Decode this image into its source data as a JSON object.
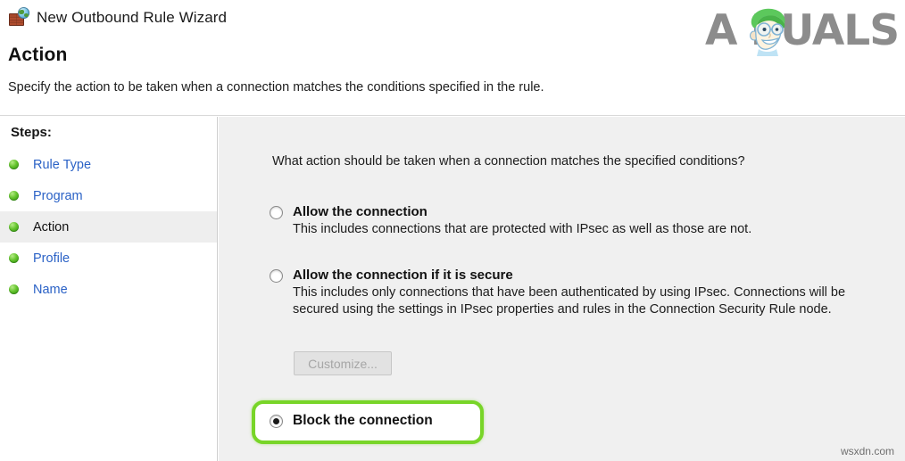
{
  "window": {
    "title": "New Outbound Rule Wizard",
    "icon": "firewall-globe-icon"
  },
  "header": {
    "page_title": "Action",
    "subtitle": "Specify the action to be taken when a connection matches the conditions specified in the rule."
  },
  "logo": {
    "text": "A      PUALS",
    "alt": "appuals-logo",
    "hair_color": "#5cc85c",
    "text_color": "#8c8c8c"
  },
  "sidebar": {
    "heading": "Steps:",
    "items": [
      {
        "label": "Rule Type",
        "state": "completed"
      },
      {
        "label": "Program",
        "state": "completed"
      },
      {
        "label": "Action",
        "state": "current"
      },
      {
        "label": "Profile",
        "state": "completed"
      },
      {
        "label": "Name",
        "state": "completed"
      }
    ]
  },
  "main": {
    "question": "What action should be taken when a connection matches the specified conditions?",
    "options": [
      {
        "id": "allow",
        "title": "Allow the connection",
        "description": "This includes connections that are protected with IPsec as well as those are not.",
        "selected": false
      },
      {
        "id": "allow-if-secure",
        "title": "Allow the connection if it is secure",
        "description": "This includes only connections that have been authenticated by using IPsec.  Connections will be secured using the settings in IPsec properties and rules in the Connection Security Rule node.",
        "selected": false
      },
      {
        "id": "block",
        "title": "Block the connection",
        "description": "",
        "selected": true
      }
    ],
    "customize_button": {
      "label": "Customize...",
      "enabled": false
    },
    "highlight": {
      "target": "block",
      "color": "#78d528"
    }
  },
  "watermark": "wsxdn.com"
}
